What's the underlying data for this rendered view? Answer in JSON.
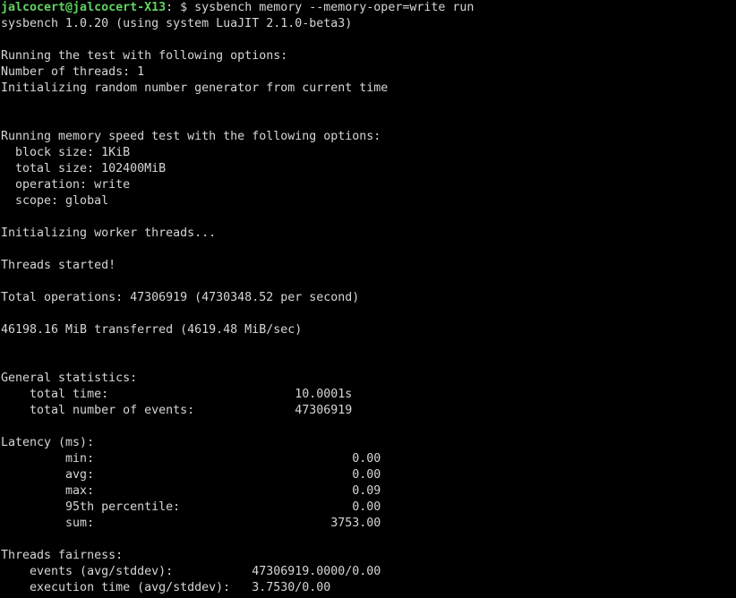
{
  "prompt": {
    "user_host": "jalcocert@jalcocert-X13",
    "separator": ":",
    "dollar": " $ ",
    "command": "sysbench memory --memory-oper=write run"
  },
  "output_lines": [
    "sysbench 1.0.20 (using system LuaJIT 2.1.0-beta3)",
    "",
    "Running the test with following options:",
    "Number of threads: 1",
    "Initializing random number generator from current time",
    "",
    "",
    "Running memory speed test with the following options:",
    "  block size: 1KiB",
    "  total size: 102400MiB",
    "  operation: write",
    "  scope: global",
    "",
    "Initializing worker threads...",
    "",
    "Threads started!",
    "",
    "Total operations: 47306919 (4730348.52 per second)",
    "",
    "46198.16 MiB transferred (4619.48 MiB/sec)",
    "",
    "",
    "General statistics:",
    "    total time:                          10.0001s",
    "    total number of events:              47306919",
    "",
    "Latency (ms):",
    "         min:                                    0.00",
    "         avg:                                    0.00",
    "         max:                                    0.09",
    "         95th percentile:                        0.00",
    "         sum:                                 3753.00",
    "",
    "Threads fairness:",
    "    events (avg/stddev):           47306919.0000/0.00",
    "    execution time (avg/stddev):   3.7530/0.00"
  ],
  "colors": {
    "background": "#000000",
    "text": "#d6d6d6",
    "prompt_user": "#5fd35f"
  }
}
